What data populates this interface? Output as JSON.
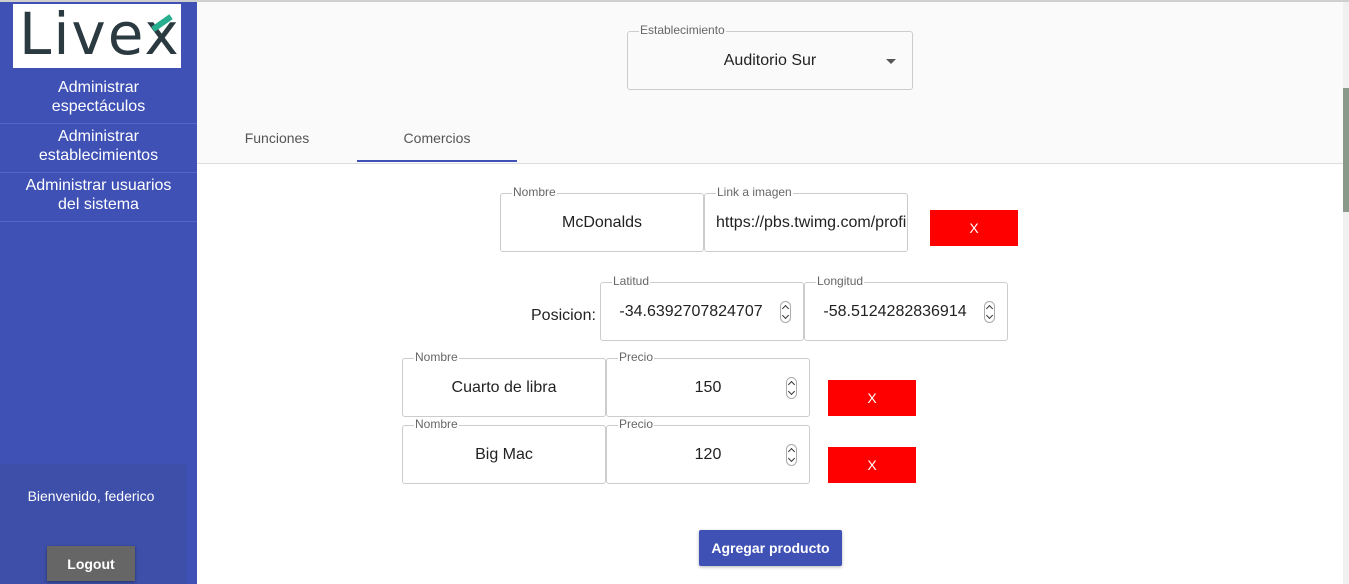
{
  "sidebar": {
    "logo_text": "Livex",
    "items": [
      {
        "line1": "Administrar",
        "line2": "espectáculos"
      },
      {
        "line1": "Administrar",
        "line2": "establecimientos"
      },
      {
        "line1": "Administrar usuarios",
        "line2": "del sistema"
      }
    ],
    "welcome": "Bienvenido, federico",
    "logout_label": "Logout"
  },
  "header": {
    "establishment_label": "Establecimiento",
    "establishment_value": "Auditorio Sur",
    "tabs": [
      {
        "label": "Funciones",
        "active": false
      },
      {
        "label": "Comercios",
        "active": true
      }
    ]
  },
  "commerce": {
    "name_label": "Nombre",
    "name_value": "McDonalds",
    "image_label": "Link a imagen",
    "image_value": "https://pbs.twimg.com/profile_images",
    "delete_label": "X",
    "position_label": "Posicion:",
    "lat_label": "Latitud",
    "lat_value": "-34.6392707824707",
    "lng_label": "Longitud",
    "lng_value": "-58.5124282836914"
  },
  "products": [
    {
      "name_label": "Nombre",
      "name": "Cuarto de libra",
      "price_label": "Precio",
      "price": "150",
      "delete_label": "X"
    },
    {
      "name_label": "Nombre",
      "name": "Big Mac",
      "price_label": "Precio",
      "price": "120",
      "delete_label": "X"
    }
  ],
  "add_product_label": "Agregar producto",
  "colors": {
    "sidebar": "#3f51b5",
    "primary": "#3f51b5",
    "danger": "#ff0000",
    "logout": "#666666"
  }
}
